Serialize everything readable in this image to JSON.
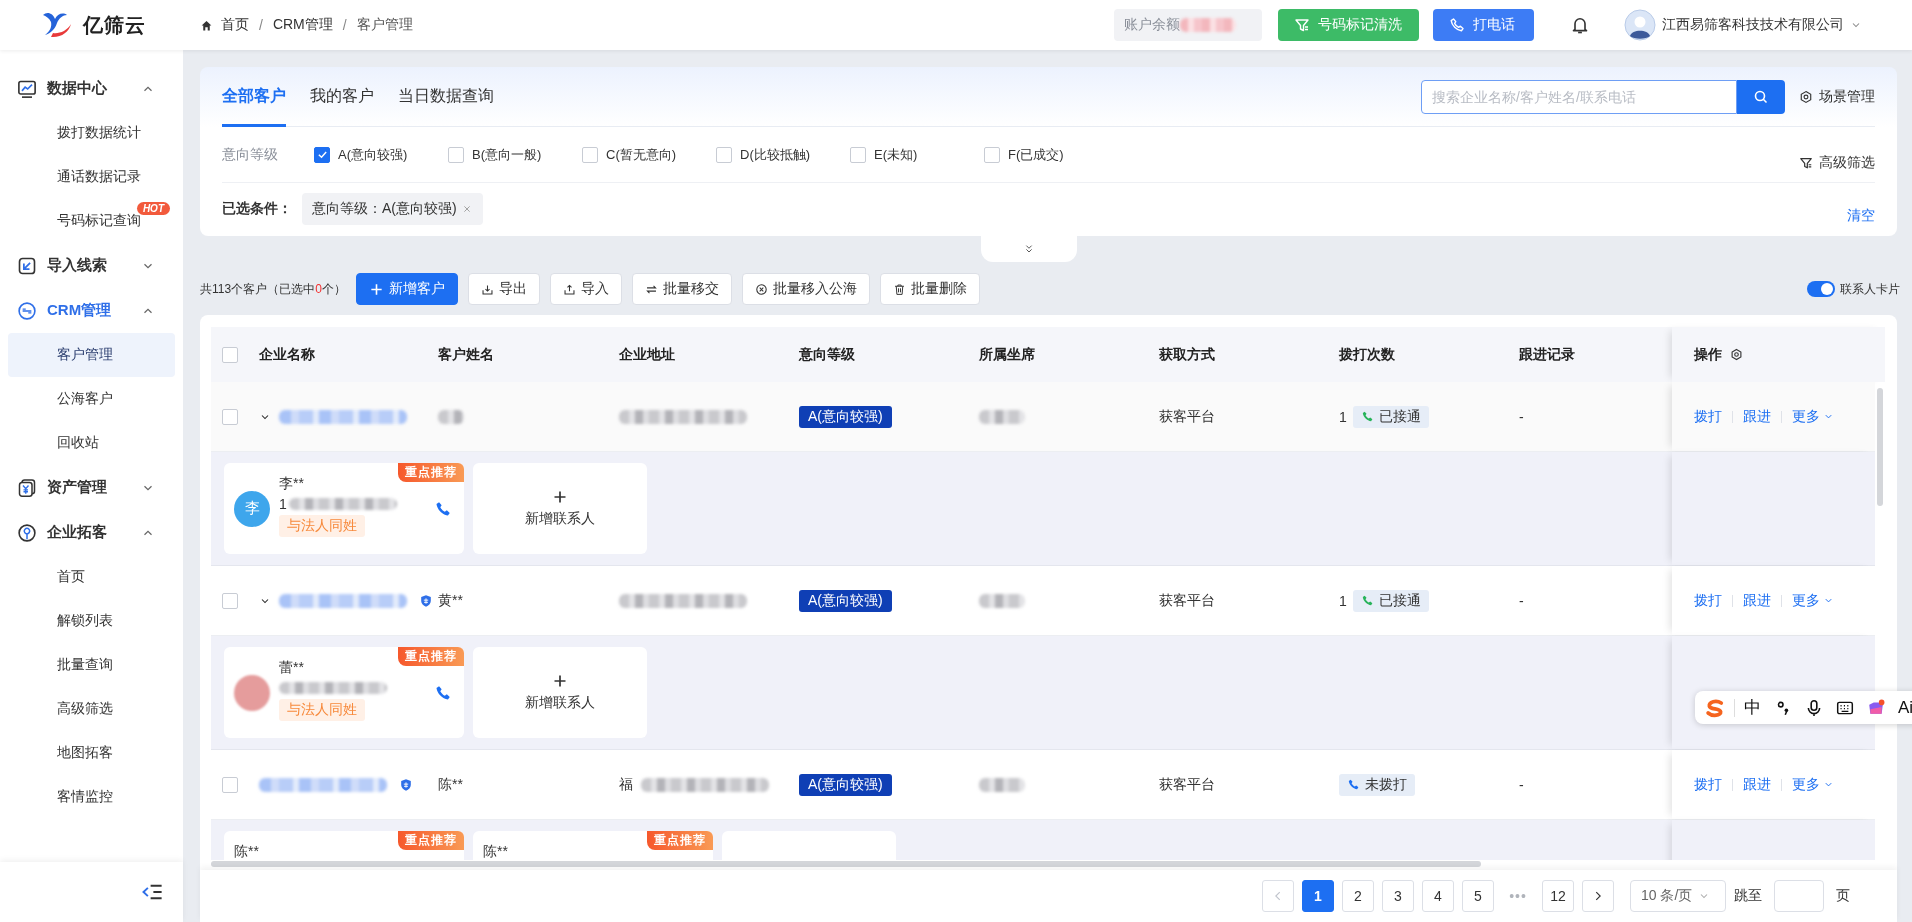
{
  "header": {
    "logo": "亿筛云",
    "breadcrumb": [
      "首页",
      "CRM管理",
      "客户管理"
    ],
    "breadcrumb_separator": "/",
    "balance_label": "账户余额",
    "balance_masked": true,
    "buttons": [
      {
        "label": "号码标记清洗",
        "kind": "green"
      },
      {
        "label": "打电话",
        "kind": "blue"
      }
    ],
    "company": "江西易筛客科技技术有限公司"
  },
  "sidebar": {
    "groups": [
      {
        "label": "数据中心",
        "expanded": true,
        "active": false,
        "children": [
          {
            "label": "拨打数据统计",
            "selected": false
          },
          {
            "label": "通话数据记录",
            "selected": false
          },
          {
            "label": "号码标记查询",
            "selected": false,
            "badge": "HOT"
          }
        ]
      },
      {
        "label": "导入线索",
        "expanded": false,
        "active": false
      },
      {
        "label": "CRM管理",
        "expanded": true,
        "active": true,
        "children": [
          {
            "label": "客户管理",
            "selected": true
          },
          {
            "label": "公海客户",
            "selected": false
          },
          {
            "label": "回收站",
            "selected": false
          }
        ]
      },
      {
        "label": "资产管理",
        "expanded": false,
        "active": false
      },
      {
        "label": "企业拓客",
        "expanded": true,
        "active": false,
        "children": [
          {
            "label": "首页",
            "selected": false
          },
          {
            "label": "解锁列表",
            "selected": false
          },
          {
            "label": "批量查询",
            "selected": false
          },
          {
            "label": "高级筛选",
            "selected": false
          },
          {
            "label": "地图拓客",
            "selected": false
          },
          {
            "label": "客情监控",
            "selected": false
          }
        ]
      }
    ]
  },
  "filter": {
    "tabs": [
      {
        "label": "全部客户",
        "selected": true
      },
      {
        "label": "我的客户",
        "selected": false
      },
      {
        "label": "当日数据查询",
        "selected": false
      }
    ],
    "search": {
      "placeholder": "搜索企业名称/客户姓名/联系电话"
    },
    "scene_button": "场景管理",
    "intent_label": "意向等级",
    "options": [
      {
        "label": "A(意向较强)",
        "checked": true
      },
      {
        "label": "B(意向一般)",
        "checked": false
      },
      {
        "label": "C(暂无意向)",
        "checked": false
      },
      {
        "label": "D(比较抵触)",
        "checked": false
      },
      {
        "label": "E(未知)",
        "checked": false
      },
      {
        "label": "F(已成交)",
        "checked": false
      }
    ],
    "advanced_button": "高级筛选",
    "selected_label": "已选条件：",
    "selected_tags": [
      "意向等级：A(意向较强)"
    ],
    "clear": "清空"
  },
  "toolbar": {
    "count_prefix": "共113个客户（已选中",
    "selected_count": "0",
    "count_suffix": "个）",
    "buttons": [
      {
        "label": "新增客户",
        "kind": "primary"
      },
      {
        "label": "导出",
        "kind": "default"
      },
      {
        "label": "导入",
        "kind": "default"
      },
      {
        "label": "批量移交",
        "kind": "default"
      },
      {
        "label": "批量移入公海",
        "kind": "default"
      },
      {
        "label": "批量删除",
        "kind": "default"
      }
    ],
    "card_toggle": {
      "label": "联系人卡片",
      "on": true
    }
  },
  "table": {
    "all_checked": false,
    "columns": [
      "企业名称",
      "客户姓名",
      "企业地址",
      "意向等级",
      "所属坐席",
      "获取方式",
      "拨打次数",
      "跟进记录",
      "操作"
    ],
    "rows": [
      {
        "selected": false,
        "expandable": true,
        "expanded": true,
        "company_masked": true,
        "verified": false,
        "customer_masked": true,
        "address_masked": true,
        "level": "A(意向较强)",
        "agent_masked": true,
        "source": "获客平台",
        "calls": "1",
        "call_status": {
          "label": "已接通",
          "kind": "connected"
        },
        "followup": "-",
        "actions": [
          "拨打",
          "跟进",
          "更多"
        ],
        "contacts": [
          {
            "name": "李**",
            "avatar": "李",
            "color": "#3ea6ec",
            "phone": "1",
            "phone_masked": true,
            "tag": "与法人同姓",
            "badge": "重点推荐"
          }
        ],
        "add_contact": {
          "label": "新增联系人"
        }
      },
      {
        "selected": false,
        "expandable": true,
        "expanded": true,
        "company_masked": true,
        "verified": true,
        "customer": "黄**",
        "address_masked": true,
        "level": "A(意向较强)",
        "agent_masked": true,
        "source": "获客平台",
        "calls": "1",
        "call_status": {
          "label": "已接通",
          "kind": "connected"
        },
        "followup": "-",
        "actions": [
          "拨打",
          "跟进",
          "更多"
        ],
        "contacts": [
          {
            "name": "蕾**",
            "color": "#e59c9c",
            "phone_masked": true,
            "tag": "与法人同姓",
            "badge": "重点推荐"
          }
        ],
        "add_contact": {
          "label": "新增联系人"
        }
      },
      {
        "selected": false,
        "expandable": false,
        "company_masked": true,
        "verified": true,
        "customer": "陈**",
        "address": "福",
        "address_masked": true,
        "level": "A(意向较强)",
        "agent_masked": true,
        "source": "获客平台",
        "call_status": {
          "label": "未拨打",
          "kind": "not_called"
        },
        "followup": "-",
        "actions": [
          "拨打",
          "跟进",
          "更多"
        ],
        "contacts": [
          {
            "name": "陈**",
            "badge": "重点推荐"
          },
          {
            "name": "陈**",
            "badge": "重点推荐"
          }
        ],
        "add_contact": {}
      }
    ]
  },
  "pagination": {
    "pages": [
      {
        "label": "1",
        "kind": "page",
        "selected": true
      },
      {
        "label": "2",
        "kind": "page",
        "selected": false
      },
      {
        "label": "3",
        "kind": "page",
        "selected": false
      },
      {
        "label": "4",
        "kind": "page",
        "selected": false
      },
      {
        "label": "5",
        "kind": "page",
        "selected": false
      },
      {
        "label": "•••",
        "kind": "ellipsis"
      },
      {
        "label": "12",
        "kind": "page",
        "selected": false
      }
    ],
    "page_size": "10 条/页",
    "jump_label": "跳至",
    "page_unit": "页"
  },
  "ime": {
    "mode": "中",
    "ai": "Ai"
  }
}
